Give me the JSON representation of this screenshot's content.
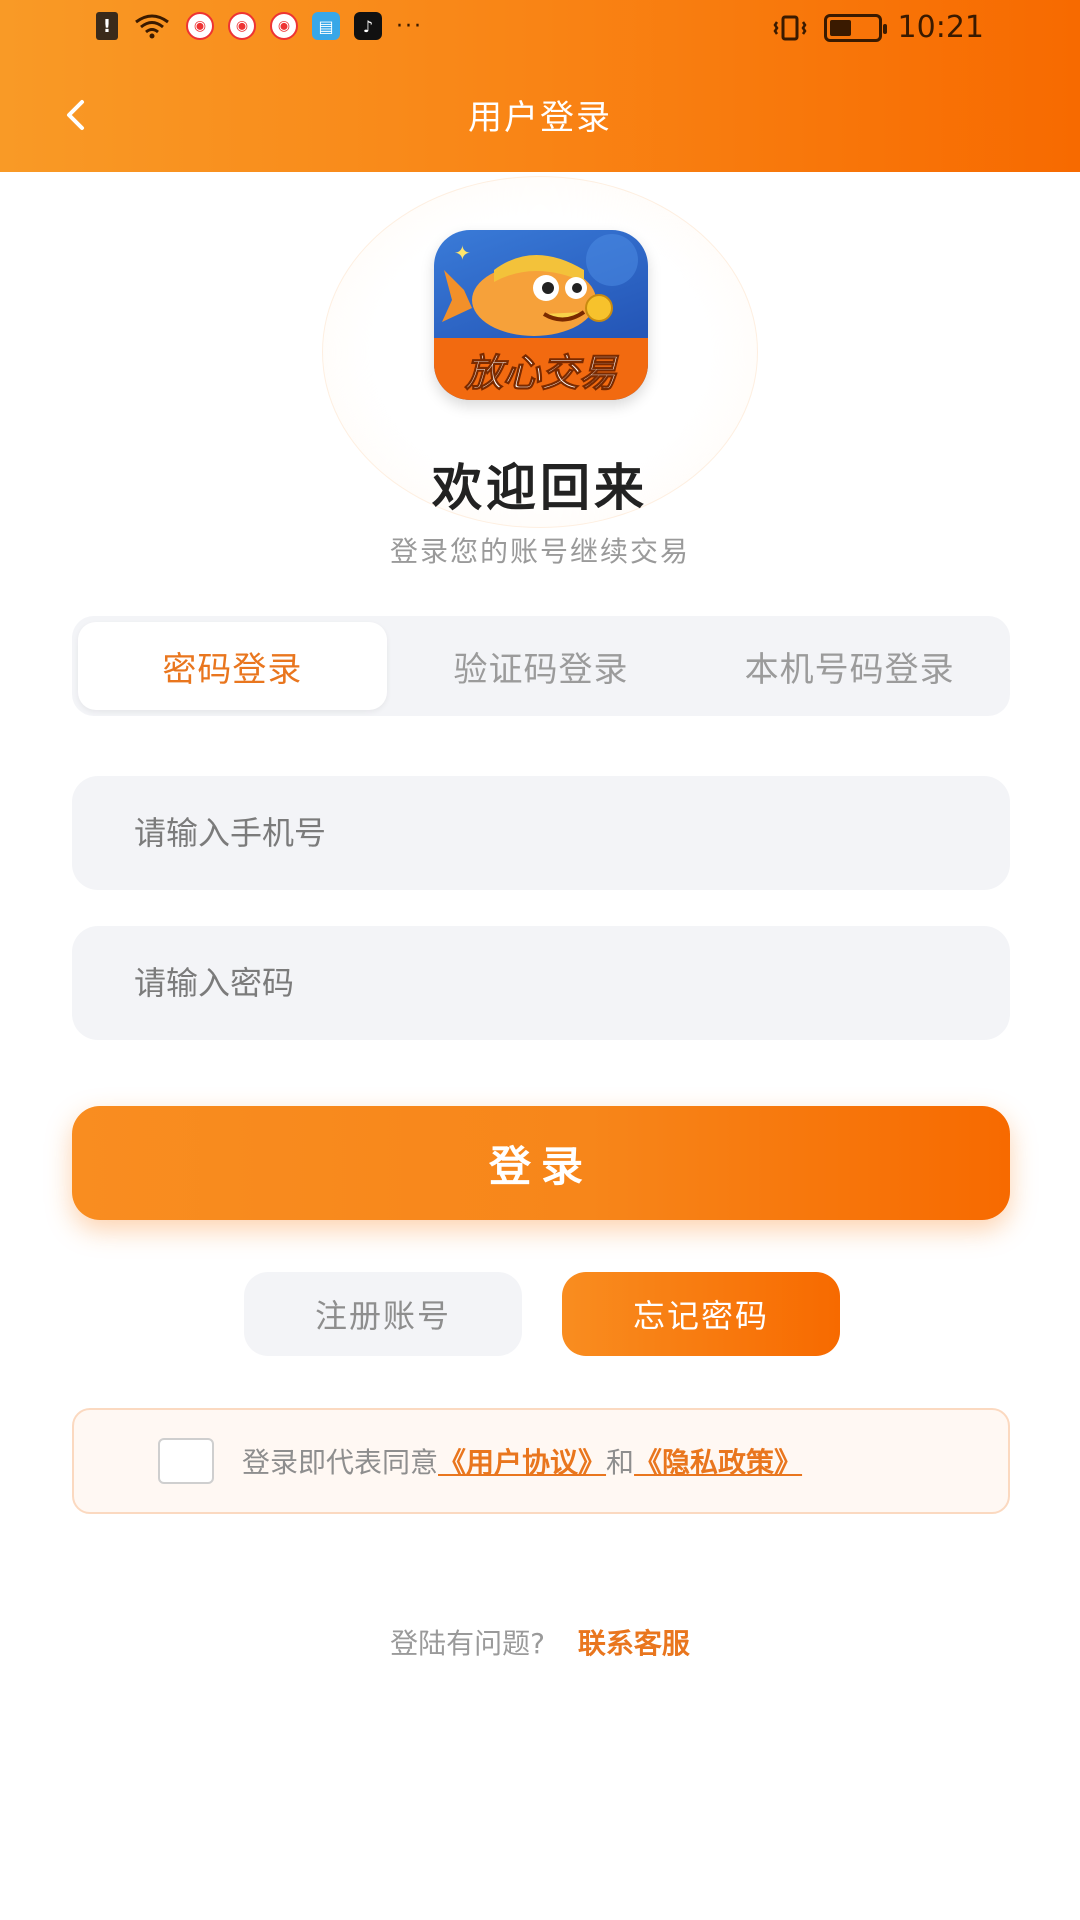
{
  "status_bar": {
    "time": "10:21",
    "battery_level": 0.45,
    "more_indicator": "···"
  },
  "header": {
    "title": "用户登录"
  },
  "logo": {
    "text": "放心交易"
  },
  "welcome": {
    "title": "欢迎回来",
    "subtitle": "登录您的账号继续交易"
  },
  "tabs": [
    {
      "label": "密码登录",
      "active": true
    },
    {
      "label": "验证码登录",
      "active": false
    },
    {
      "label": "本机号码登录",
      "active": false
    }
  ],
  "form": {
    "phone_placeholder": "请输入手机号",
    "password_placeholder": "请输入密码",
    "login_label": "登录"
  },
  "actions": {
    "register_label": "注册账号",
    "forgot_label": "忘记密码"
  },
  "agreement": {
    "prefix": "登录即代表同意",
    "user_agreement": "《用户协议》",
    "and": "和",
    "privacy_policy": "《隐私政策》",
    "checked": false
  },
  "help": {
    "question": "登陆有问题?",
    "contact": "联系客服"
  },
  "colors": {
    "accent": "#f98415",
    "accent_dark": "#f76a00",
    "link": "#e9761e"
  }
}
